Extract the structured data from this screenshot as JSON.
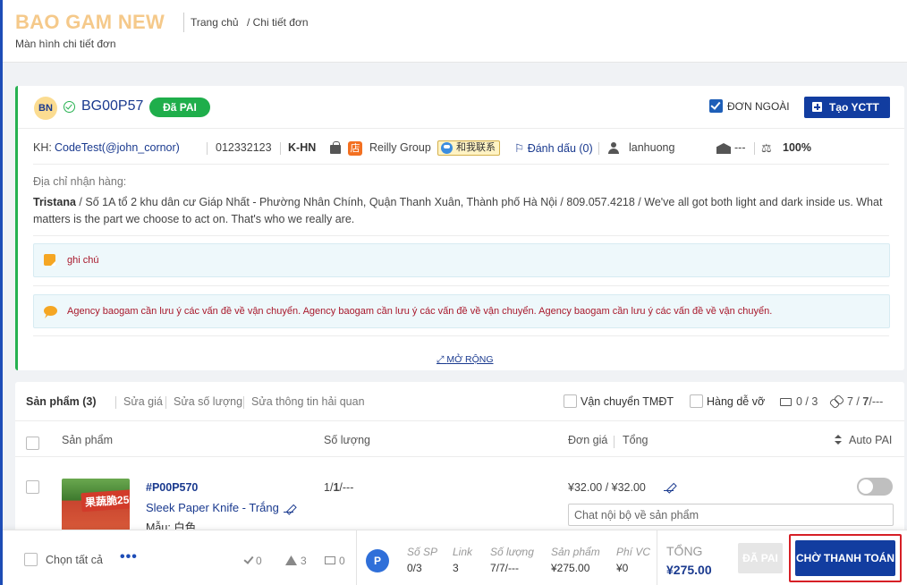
{
  "header": {
    "brand": "BAO GAM NEW",
    "subtitle": "Màn hình chi tiết đơn",
    "breadcrumb": [
      "Trang chủ",
      "/ Chi tiết đơn"
    ]
  },
  "order": {
    "avatar_initials": "BN",
    "code": "BG00P57",
    "status": "Đã PAI",
    "external_label": "ĐƠN NGOÀI",
    "external_checked": true,
    "create_button": "Tạo YCTT",
    "customer_prefix": "KH:",
    "customer_name": "CodeTest(@john_cornor)",
    "phone": "012332123",
    "warehouse_code": "K-HN",
    "shop_name": "Reilly Group",
    "contact_badge": "和我联系",
    "mark_label": "Đánh dấu (0)",
    "staff": "lanhuong",
    "warehouse_value": "---",
    "percent": "100%",
    "address_label": "Địa chỉ nhận hàng:",
    "recipient": "Tristana",
    "address": " / Số 1A tổ 2 khu dân cư Giáp Nhất - Phường Nhân Chính, Quận Thanh Xuân, Thành phố Hà Nội / 809.057.4218 / We've all got both light and dark inside us. What matters is the part we choose to act on. That's who we really are.",
    "note": "ghi chú",
    "agency_note": "Agency baogam cần lưu ý các vấn đề về vận chuyển. Agency baogam cần lưu ý các vấn đề về vận chuyển. Agency baogam cần lưu ý các vấn đề về vận chuyển.",
    "expand_label": "MỞ RỘNG",
    "colors": {
      "status_green": "#1fae4b",
      "primary_blue": "#123da0",
      "brand_gold": "#f5c98a"
    }
  },
  "products": {
    "title": "Sản phẩm (3)",
    "actions": [
      "Sửa giá",
      "Sửa số lượng",
      "Sửa thông tin hải quan"
    ],
    "shipping_tmdt": "Vận chuyển TMĐT",
    "fragile": "Hàng dễ vỡ",
    "message_count": "0 / 3",
    "link_count_a": "7 /",
    "link_count_b": "7",
    "link_count_c": "/---",
    "columns": {
      "product": "Sản phẩm",
      "quantity": "Số lượng",
      "price": "Đơn giá",
      "total": "Tổng",
      "auto_pai": "Auto PAI"
    },
    "items": [
      {
        "thumb_text": "果蔬脆250",
        "code": "#P00P570",
        "name": "Sleek Paper Knife - Trắng",
        "variant": "Mẫu: 白色",
        "qty_a": "1/",
        "qty_b": "1",
        "qty_c": "/---",
        "price": "¥32.00 / ¥32.00",
        "auto_pai": false,
        "chat_placeholder": "Chat nội bộ về sản phẩm"
      }
    ]
  },
  "footer": {
    "select_all": "Chọn tất cả",
    "more": "•••",
    "stat_done": "0",
    "stat_warn": "3",
    "stat_mail": "0",
    "badge": "P",
    "summary": [
      {
        "label": "Số SP",
        "value": "0/3"
      },
      {
        "label": "Link",
        "value": "3"
      },
      {
        "label": "Số lượng",
        "value": "7/7/---"
      },
      {
        "label": "Sản phẩm",
        "value": "¥275.00"
      },
      {
        "label": "Phí VC",
        "value": "¥0"
      }
    ],
    "total_label": "TỔNG",
    "total_value": "¥275.00",
    "paid_button": "ĐÃ PAI",
    "pay_button": "CHỜ THANH TOÁN"
  }
}
